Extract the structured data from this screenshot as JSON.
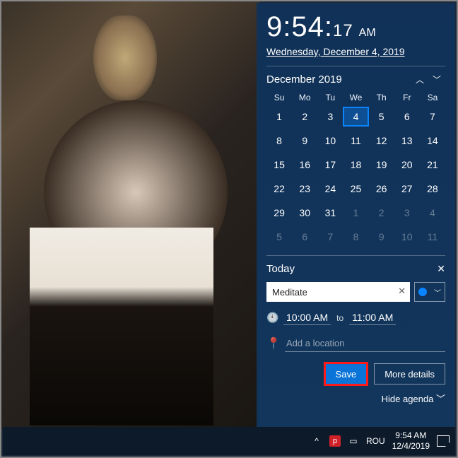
{
  "clock": {
    "hm": "9:54:",
    "sec": "17",
    "ampm": "AM",
    "date": "Wednesday, December 4, 2019"
  },
  "calendar": {
    "month": "December 2019",
    "dow": [
      "Su",
      "Mo",
      "Tu",
      "We",
      "Th",
      "Fr",
      "Sa"
    ],
    "weeks": [
      [
        {
          "n": "1"
        },
        {
          "n": "2"
        },
        {
          "n": "3"
        },
        {
          "n": "4",
          "sel": true
        },
        {
          "n": "5"
        },
        {
          "n": "6"
        },
        {
          "n": "7"
        }
      ],
      [
        {
          "n": "8"
        },
        {
          "n": "9"
        },
        {
          "n": "10"
        },
        {
          "n": "11"
        },
        {
          "n": "12"
        },
        {
          "n": "13"
        },
        {
          "n": "14"
        }
      ],
      [
        {
          "n": "15"
        },
        {
          "n": "16"
        },
        {
          "n": "17"
        },
        {
          "n": "18"
        },
        {
          "n": "19"
        },
        {
          "n": "20"
        },
        {
          "n": "21"
        }
      ],
      [
        {
          "n": "22"
        },
        {
          "n": "23"
        },
        {
          "n": "24"
        },
        {
          "n": "25"
        },
        {
          "n": "26"
        },
        {
          "n": "27"
        },
        {
          "n": "28"
        }
      ],
      [
        {
          "n": "29"
        },
        {
          "n": "30"
        },
        {
          "n": "31"
        },
        {
          "n": "1",
          "dim": true
        },
        {
          "n": "2",
          "dim": true
        },
        {
          "n": "3",
          "dim": true
        },
        {
          "n": "4",
          "dim": true
        }
      ],
      [
        {
          "n": "5",
          "dim": true
        },
        {
          "n": "6",
          "dim": true
        },
        {
          "n": "7",
          "dim": true
        },
        {
          "n": "8",
          "dim": true
        },
        {
          "n": "9",
          "dim": true
        },
        {
          "n": "10",
          "dim": true
        },
        {
          "n": "11",
          "dim": true
        }
      ]
    ]
  },
  "agenda": {
    "heading": "Today",
    "event_name": "Meditate",
    "start": "10:00 AM",
    "to": "to",
    "end": "11:00 AM",
    "location_placeholder": "Add a location",
    "save": "Save",
    "more": "More details",
    "hide": "Hide agenda"
  },
  "taskbar": {
    "lang": "ROU",
    "time": "9:54 AM",
    "date": "12/4/2019"
  }
}
